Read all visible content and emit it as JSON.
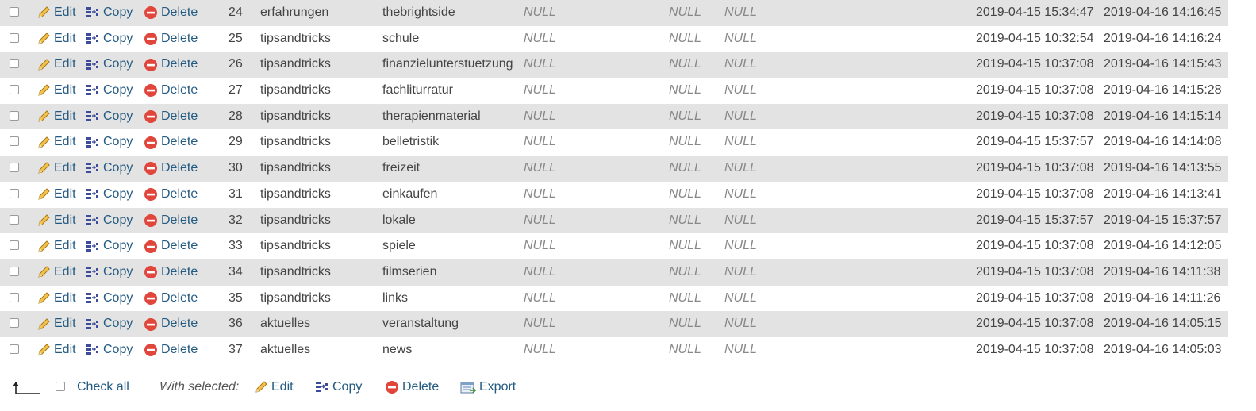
{
  "rows": [
    {
      "id": "24",
      "category": "erfahrungen",
      "name": "thebrightside",
      "null1": "NULL",
      "null2": "NULL",
      "null3": "NULL",
      "created": "2019-04-15 15:34:47",
      "updated": "2019-04-16 14:16:45"
    },
    {
      "id": "25",
      "category": "tipsandtricks",
      "name": "schule",
      "null1": "NULL",
      "null2": "NULL",
      "null3": "NULL",
      "created": "2019-04-15 10:32:54",
      "updated": "2019-04-16 14:16:24"
    },
    {
      "id": "26",
      "category": "tipsandtricks",
      "name": "finanzielunterstuetzung",
      "null1": "NULL",
      "null2": "NULL",
      "null3": "NULL",
      "created": "2019-04-15 10:37:08",
      "updated": "2019-04-16 14:15:43"
    },
    {
      "id": "27",
      "category": "tipsandtricks",
      "name": "fachliturratur",
      "null1": "NULL",
      "null2": "NULL",
      "null3": "NULL",
      "created": "2019-04-15 10:37:08",
      "updated": "2019-04-16 14:15:28"
    },
    {
      "id": "28",
      "category": "tipsandtricks",
      "name": "therapienmaterial",
      "null1": "NULL",
      "null2": "NULL",
      "null3": "NULL",
      "created": "2019-04-15 10:37:08",
      "updated": "2019-04-16 14:15:14"
    },
    {
      "id": "29",
      "category": "tipsandtricks",
      "name": "belletristik",
      "null1": "NULL",
      "null2": "NULL",
      "null3": "NULL",
      "created": "2019-04-15 15:37:57",
      "updated": "2019-04-16 14:14:08"
    },
    {
      "id": "30",
      "category": "tipsandtricks",
      "name": "freizeit",
      "null1": "NULL",
      "null2": "NULL",
      "null3": "NULL",
      "created": "2019-04-15 10:37:08",
      "updated": "2019-04-16 14:13:55"
    },
    {
      "id": "31",
      "category": "tipsandtricks",
      "name": "einkaufen",
      "null1": "NULL",
      "null2": "NULL",
      "null3": "NULL",
      "created": "2019-04-15 10:37:08",
      "updated": "2019-04-16 14:13:41"
    },
    {
      "id": "32",
      "category": "tipsandtricks",
      "name": "lokale",
      "null1": "NULL",
      "null2": "NULL",
      "null3": "NULL",
      "created": "2019-04-15 15:37:57",
      "updated": "2019-04-15 15:37:57"
    },
    {
      "id": "33",
      "category": "tipsandtricks",
      "name": "spiele",
      "null1": "NULL",
      "null2": "NULL",
      "null3": "NULL",
      "created": "2019-04-15 10:37:08",
      "updated": "2019-04-16 14:12:05"
    },
    {
      "id": "34",
      "category": "tipsandtricks",
      "name": "filmserien",
      "null1": "NULL",
      "null2": "NULL",
      "null3": "NULL",
      "created": "2019-04-15 10:37:08",
      "updated": "2019-04-16 14:11:38"
    },
    {
      "id": "35",
      "category": "tipsandtricks",
      "name": "links",
      "null1": "NULL",
      "null2": "NULL",
      "null3": "NULL",
      "created": "2019-04-15 10:37:08",
      "updated": "2019-04-16 14:11:26"
    },
    {
      "id": "36",
      "category": "aktuelles",
      "name": "veranstaltung",
      "null1": "NULL",
      "null2": "NULL",
      "null3": "NULL",
      "created": "2019-04-15 10:37:08",
      "updated": "2019-04-16 14:05:15"
    },
    {
      "id": "37",
      "category": "aktuelles",
      "name": "news",
      "null1": "NULL",
      "null2": "NULL",
      "null3": "NULL",
      "created": "2019-04-15 10:37:08",
      "updated": "2019-04-16 14:05:03"
    }
  ],
  "row_actions": {
    "edit": "Edit",
    "copy": "Copy",
    "delete": "Delete"
  },
  "footer": {
    "check_all": "Check all",
    "with_selected": "With selected:",
    "edit": "Edit",
    "copy": "Copy",
    "delete": "Delete",
    "export": "Export"
  },
  "colors": {
    "link": "#235a81",
    "row_alt": "#e3e3e3",
    "null_text": "#888888"
  },
  "icons": {
    "edit": "pencil-icon",
    "copy": "copy-icon",
    "delete": "delete-icon",
    "export": "export-icon",
    "arrow": "arrow-up-left-icon"
  }
}
